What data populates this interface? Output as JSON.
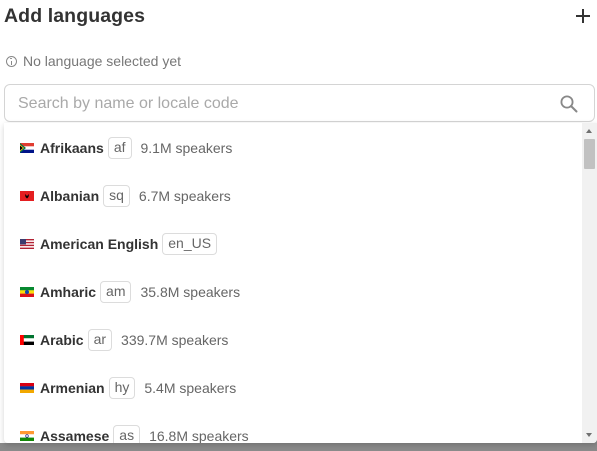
{
  "header": {
    "title": "Add languages"
  },
  "status": {
    "text": "No language selected yet"
  },
  "search": {
    "placeholder": "Search by name or locale code",
    "value": ""
  },
  "languages": [
    {
      "name": "Afrikaans",
      "code": "af",
      "speakers": "9.1M speakers",
      "flag": "south-africa-flag"
    },
    {
      "name": "Albanian",
      "code": "sq",
      "speakers": "6.7M speakers",
      "flag": "albania-flag"
    },
    {
      "name": "American English",
      "code": "en_US",
      "speakers": "",
      "flag": "united-states-flag"
    },
    {
      "name": "Amharic",
      "code": "am",
      "speakers": "35.8M speakers",
      "flag": "ethiopia-flag"
    },
    {
      "name": "Arabic",
      "code": "ar",
      "speakers": "339.7M speakers",
      "flag": "uae-flag"
    },
    {
      "name": "Armenian",
      "code": "hy",
      "speakers": "5.4M speakers",
      "flag": "armenia-flag"
    },
    {
      "name": "Assamese",
      "code": "as",
      "speakers": "16.8M speakers",
      "flag": "india-flag"
    }
  ],
  "colors": {
    "text": "#333333",
    "muted": "#777777",
    "border": "#d4d4d4",
    "backdrop": "#8a8a8a"
  }
}
